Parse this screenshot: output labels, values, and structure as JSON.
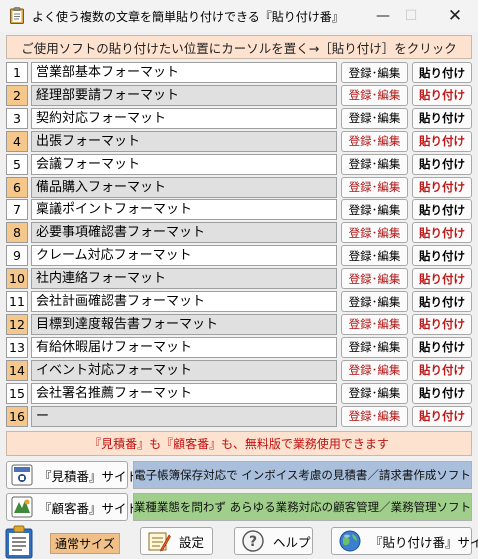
{
  "window": {
    "title": "よく使う複数の文章を簡単貼り付けできる『貼り付け番』",
    "minimize": "—",
    "maximize": "☐",
    "close": "✕"
  },
  "hint": "ご使用ソフトの貼り付けたい位置にカーソルを置く→［貼り付け］をクリック",
  "row_buttons": {
    "register_edit": "登録･編集",
    "paste": "貼り付け"
  },
  "rows": [
    {
      "num": "1",
      "name": "営業部基本フォーマット"
    },
    {
      "num": "2",
      "name": "経理部要請フォーマット"
    },
    {
      "num": "3",
      "name": "契約対応フォーマット"
    },
    {
      "num": "4",
      "name": "出張フォーマット"
    },
    {
      "num": "5",
      "name": "会議フォーマット"
    },
    {
      "num": "6",
      "name": "備品購入フォーマット"
    },
    {
      "num": "7",
      "name": "稟議ポイントフォーマット"
    },
    {
      "num": "8",
      "name": "必要事項確認書フォーマット"
    },
    {
      "num": "9",
      "name": "クレーム対応フォーマット"
    },
    {
      "num": "10",
      "name": "社内連絡フォーマット"
    },
    {
      "num": "11",
      "name": "会社計画確認書フォーマット"
    },
    {
      "num": "12",
      "name": "目標到達度報告書フォーマット"
    },
    {
      "num": "13",
      "name": "有給休暇届けフォーマット"
    },
    {
      "num": "14",
      "name": "イベント対応フォーマット"
    },
    {
      "num": "15",
      "name": "会社署名推薦フォーマット"
    },
    {
      "num": "16",
      "name": "ー"
    }
  ],
  "notice": "『見積番』も『顧客番』も、無料版で業務使用できます",
  "links": [
    {
      "label": "『見積番』サイト",
      "icon": "mitsumori-app-icon",
      "promo": "電子帳簿保存対応で インボイス考慮の見積書／請求書作成ソフト"
    },
    {
      "label": "『顧客番』サイト",
      "icon": "kokyaku-app-icon",
      "promo": "業種業態を問わず あらゆる業務対応の顧客管理／業務管理ソフト"
    }
  ],
  "bottom": {
    "size_label": "通常サイズ",
    "settings": "設定",
    "help": "ヘルプ",
    "site": "『貼り付け番』サイト"
  },
  "colors": {
    "accent_orange": "#f6c78a",
    "hint_background": "#fde2cf",
    "notice_text": "#c01010",
    "promo_blue": "#a9bfdc",
    "promo_green": "#9fcf8a"
  }
}
